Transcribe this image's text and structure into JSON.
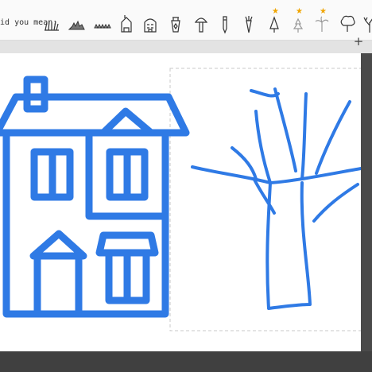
{
  "suggestions": {
    "label": "Did you mean:",
    "items": [
      {
        "name": "grass-1-icon"
      },
      {
        "name": "grass-2-icon"
      },
      {
        "name": "grass-3-icon"
      },
      {
        "name": "house-1-icon"
      },
      {
        "name": "house-2-icon"
      },
      {
        "name": "lantern-icon"
      },
      {
        "name": "mushroom-icon"
      },
      {
        "name": "pencil-icon"
      },
      {
        "name": "carrot-icon"
      },
      {
        "name": "pine-tree-1-icon",
        "starred": true
      },
      {
        "name": "pine-tree-2-icon",
        "starred": true
      },
      {
        "name": "palm-tree-icon",
        "starred": true
      },
      {
        "name": "deciduous-tree-icon"
      },
      {
        "name": "bare-tree-icon"
      }
    ]
  },
  "toolbar": {
    "add_symbol": "+"
  },
  "colors": {
    "stroke": "#2f7ae5",
    "star": "#f0a500"
  }
}
